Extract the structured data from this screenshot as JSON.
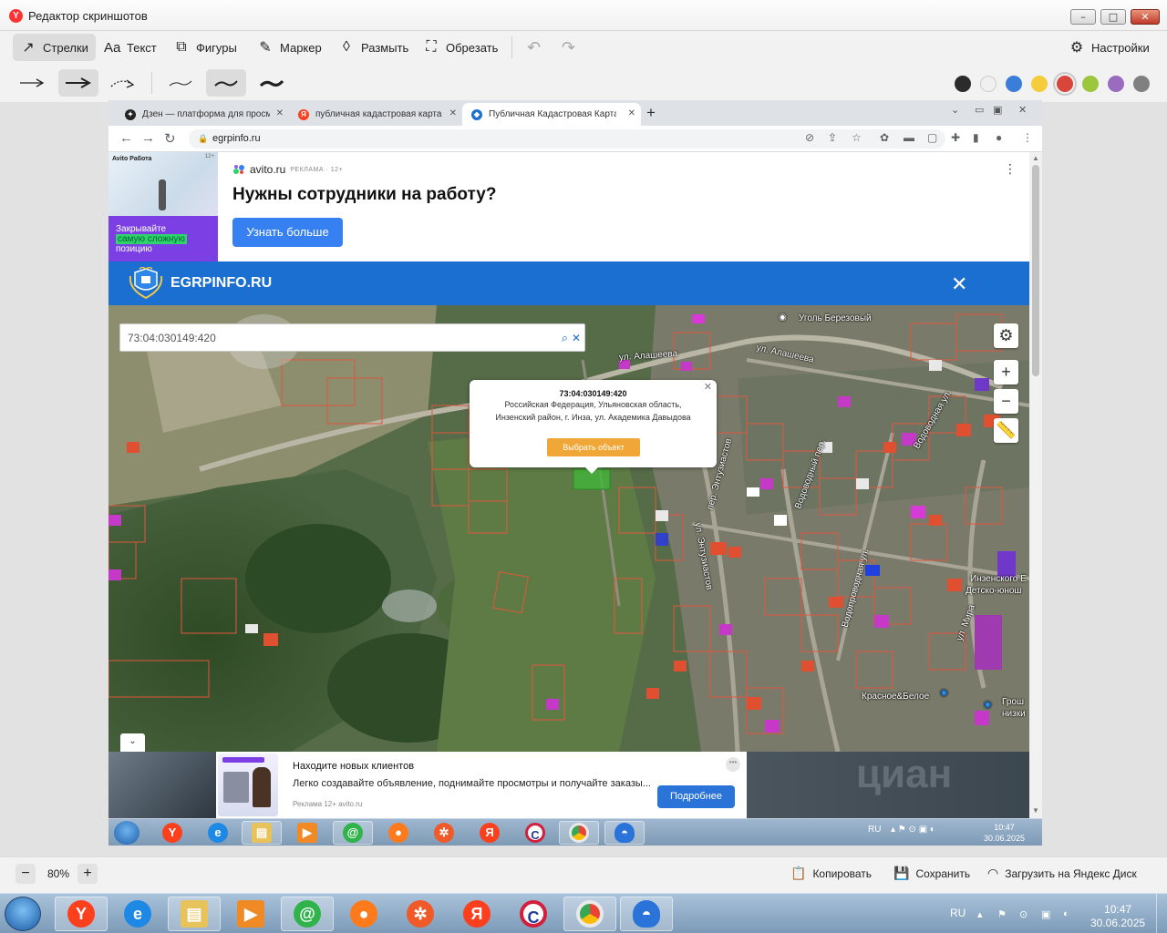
{
  "editor": {
    "title": "Редактор скриншотов",
    "logo_letter": "Y",
    "tools": [
      {
        "label": "Стрелки",
        "icon": "arrow-icon"
      },
      {
        "label": "Текст",
        "icon": "text-icon"
      },
      {
        "label": "Фигуры",
        "icon": "shapes-icon"
      },
      {
        "label": "Маркер",
        "icon": "marker-icon"
      },
      {
        "label": "Размыть",
        "icon": "blur-icon"
      },
      {
        "label": "Обрезать",
        "icon": "crop-icon"
      }
    ],
    "settings_label": "Настройки",
    "colors": [
      "#2b2b2b",
      "#f0f0f0",
      "#3b7dd8",
      "#f5cc3a",
      "#d9453a",
      "#9cc63b",
      "#9b6bc0",
      "#808080"
    ],
    "selected_color": "#d9453a",
    "zoom": "80%",
    "zoom_minus": "−",
    "zoom_plus": "+",
    "actions": {
      "copy": "Копировать",
      "save": "Сохранить",
      "upload": "Загрузить на Яндекс Диск"
    }
  },
  "browser": {
    "tabs": [
      {
        "label": "Дзен — платформа для просмотра",
        "icon": "dzen-icon",
        "fav": "#222222"
      },
      {
        "label": "публичная кадастровая карта — Я",
        "icon": "yandex-icon",
        "fav": "#fc3f1d"
      },
      {
        "label": "Публичная Кадастровая Карта России",
        "icon": "shield-icon",
        "fav": "#1a6fd1"
      }
    ],
    "url": "egrpinfo.ru"
  },
  "ad_top": {
    "brand": "Avito Работа",
    "age": "12+",
    "image_text_a": "Закрывайте",
    "image_text_hl": "самую сложную",
    "image_text_b": "позицию",
    "source": "avito.ru",
    "source_note": "РЕКЛАМА · 12+",
    "headline": "Нужны сотрудники на работу?",
    "button": "Узнать больше"
  },
  "site": {
    "name": "EGRPINFO.RU"
  },
  "map": {
    "search_value": "73:04:030149:420",
    "popup": {
      "number": "73:04:030149:420",
      "address_1": "Российская Федерация, Ульяновская область,",
      "address_2": "Инзенский район, г. Инза, ул. Академика Давыдова",
      "button": "Выбрать объект"
    },
    "labels": {
      "coal": "Уголь Березовый",
      "alasheeva_1": "ул. Алашеева",
      "alasheeva_2": "ул. Алашеева",
      "vodovodnaya": "Водоводная ул.",
      "vodovodny_per": "Водоводный пер.",
      "entuziastov_per": "пер. Энтузиастов",
      "entuziastov": "ул. Энтузиастов",
      "vodoprovodnaya": "Водопроводная ул.",
      "mira": "ул. Мира",
      "school_1": "Инзенского Е",
      "school_2": "Детско-юнош",
      "krasnoe": "Красное&Белое",
      "grosh_1": "Грош",
      "grosh_2": "низки"
    }
  },
  "ad_bottom": {
    "headline": "Находите новых клиентов",
    "desc": "Легко создавайте объявление, поднимайте просмотры и получайте заказы...",
    "source": "Реклама 12+  avito.ru",
    "button": "Подробнее",
    "watermark": "циан"
  },
  "inner_taskbar": {
    "lang": "RU",
    "time": "10:47",
    "date": "30.06.2025"
  },
  "outer_taskbar": {
    "lang": "RU",
    "time": "10:47",
    "date": "30.06.2025"
  }
}
